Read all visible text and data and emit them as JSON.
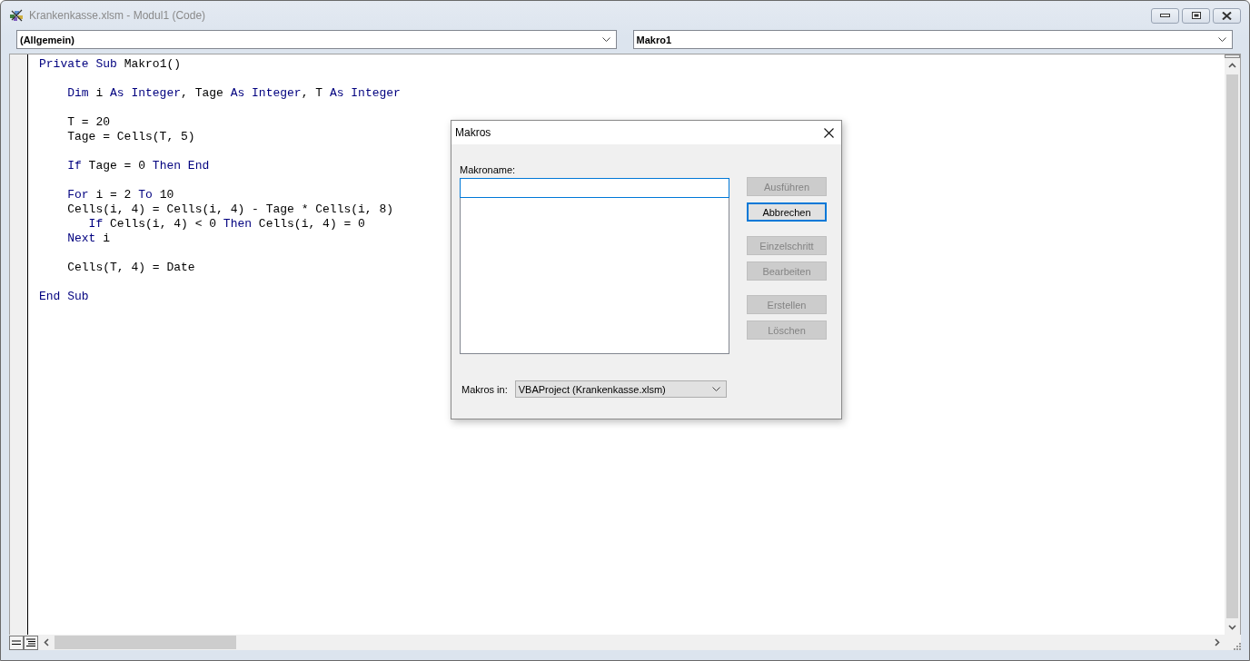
{
  "window": {
    "title": "Krankenkasse.xlsm - Modul1 (Code)"
  },
  "object_dropdown": {
    "value": "(Allgemein)"
  },
  "procedure_dropdown": {
    "value": "Makro1"
  },
  "code_lines": [
    {
      "kind": "code",
      "tokens": [
        {
          "kind": "keyword",
          "text": "Private Sub"
        },
        {
          "kind": "plain",
          "text": " Makro1()"
        }
      ]
    },
    {
      "kind": "blank"
    },
    {
      "kind": "code",
      "tokens": [
        {
          "kind": "keyword",
          "text": "    Dim"
        },
        {
          "kind": "plain",
          "text": " i "
        },
        {
          "kind": "keyword",
          "text": "As Integer"
        },
        {
          "kind": "plain",
          "text": ", Tage "
        },
        {
          "kind": "keyword",
          "text": "As Integer"
        },
        {
          "kind": "plain",
          "text": ", T "
        },
        {
          "kind": "keyword",
          "text": "As Integer"
        }
      ]
    },
    {
      "kind": "blank"
    },
    {
      "kind": "code",
      "tokens": [
        {
          "kind": "plain",
          "text": "    T = 20"
        }
      ]
    },
    {
      "kind": "code",
      "tokens": [
        {
          "kind": "plain",
          "text": "    Tage = Cells(T, 5)"
        }
      ]
    },
    {
      "kind": "blank"
    },
    {
      "kind": "code",
      "tokens": [
        {
          "kind": "keyword",
          "text": "    If"
        },
        {
          "kind": "plain",
          "text": " Tage = 0 "
        },
        {
          "kind": "keyword",
          "text": "Then End"
        }
      ]
    },
    {
      "kind": "blank"
    },
    {
      "kind": "code",
      "tokens": [
        {
          "kind": "keyword",
          "text": "    For"
        },
        {
          "kind": "plain",
          "text": " i = 2 "
        },
        {
          "kind": "keyword",
          "text": "To"
        },
        {
          "kind": "plain",
          "text": " 10"
        }
      ]
    },
    {
      "kind": "code",
      "tokens": [
        {
          "kind": "plain",
          "text": "    Cells(i, 4) = Cells(i, 4) - Tage * Cells(i, 8)"
        }
      ]
    },
    {
      "kind": "code",
      "tokens": [
        {
          "kind": "keyword",
          "text": "       If"
        },
        {
          "kind": "plain",
          "text": " Cells(i, 4) < 0 "
        },
        {
          "kind": "keyword",
          "text": "Then"
        },
        {
          "kind": "plain",
          "text": " Cells(i, 4) = 0"
        }
      ]
    },
    {
      "kind": "code",
      "tokens": [
        {
          "kind": "keyword",
          "text": "    Next"
        },
        {
          "kind": "plain",
          "text": " i"
        }
      ]
    },
    {
      "kind": "blank"
    },
    {
      "kind": "code",
      "tokens": [
        {
          "kind": "plain",
          "text": "    Cells(T, 4) = Date"
        }
      ]
    },
    {
      "kind": "blank"
    },
    {
      "kind": "code",
      "tokens": [
        {
          "kind": "keyword",
          "text": "End Sub"
        }
      ]
    }
  ],
  "dialog": {
    "title": "Makros",
    "name_label": "Makroname:",
    "button_groups": [
      [
        {
          "label": "Ausführen",
          "disabled": true,
          "default": false
        },
        {
          "label": "Abbrechen",
          "disabled": false,
          "default": true
        }
      ],
      [
        {
          "label": "Einzelschritt",
          "disabled": true,
          "default": false
        },
        {
          "label": "Bearbeiten",
          "disabled": true,
          "default": false
        }
      ],
      [
        {
          "label": "Erstellen",
          "disabled": true,
          "default": false
        },
        {
          "label": "Löschen",
          "disabled": true,
          "default": false
        }
      ]
    ],
    "macros_in_label": "Makros in:",
    "macros_in_value": "VBAProject (Krankenkasse.xlsm)"
  }
}
